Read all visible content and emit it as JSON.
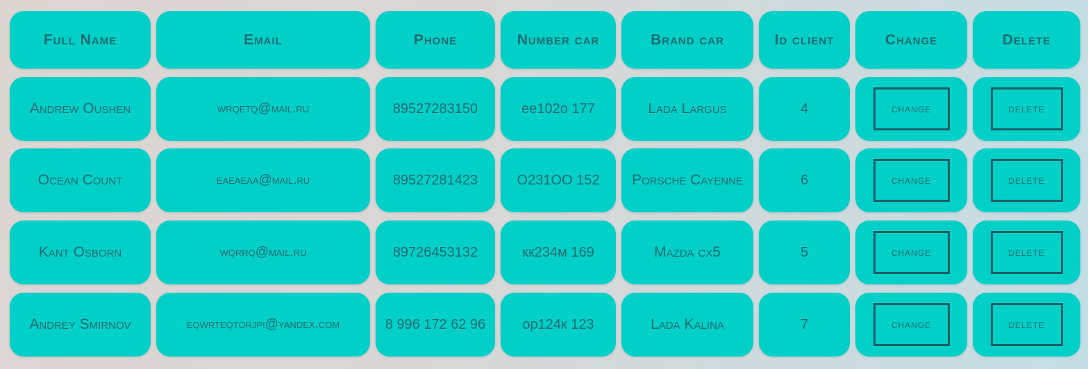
{
  "headers": [
    "Full Name",
    "Email",
    "Phone",
    "Number car",
    "Brand car",
    "Id client",
    "Change",
    "Delete"
  ],
  "rows": [
    {
      "full_name": "Andrew Oushen",
      "email": "wrqetq@mail.ru",
      "phone": "89527283150",
      "number_car": "ее102о 177",
      "brand_car": "Lada Largus",
      "id_client": "4",
      "change_label": "change",
      "delete_label": "delete"
    },
    {
      "full_name": "Ocean Count",
      "email": "eaeaeaa@mail.ru",
      "phone": "89527281423",
      "number_car": "O231OO 152",
      "brand_car": "Porsche Cayenne",
      "id_client": "6",
      "change_label": "change",
      "delete_label": "delete"
    },
    {
      "full_name": "Kant Osborn",
      "email": "wqrrq@mail.ru",
      "phone": "89726453132",
      "number_car": "кк234м 169",
      "brand_car": "Mazda cx5",
      "id_client": "5",
      "change_label": "change",
      "delete_label": "delete"
    },
    {
      "full_name": "Andrey Smirnov",
      "email": "eqwrteqtorjpi@yandex.com",
      "phone": "8 996 172 62 96",
      "number_car": "ор124к 123",
      "brand_car": "Lada Kalina",
      "id_client": "7",
      "change_label": "change",
      "delete_label": "delete"
    }
  ],
  "colors": {
    "cell_background": "#00d0c8",
    "text": "#1f6b6f",
    "button_border": "#1f5e66"
  }
}
